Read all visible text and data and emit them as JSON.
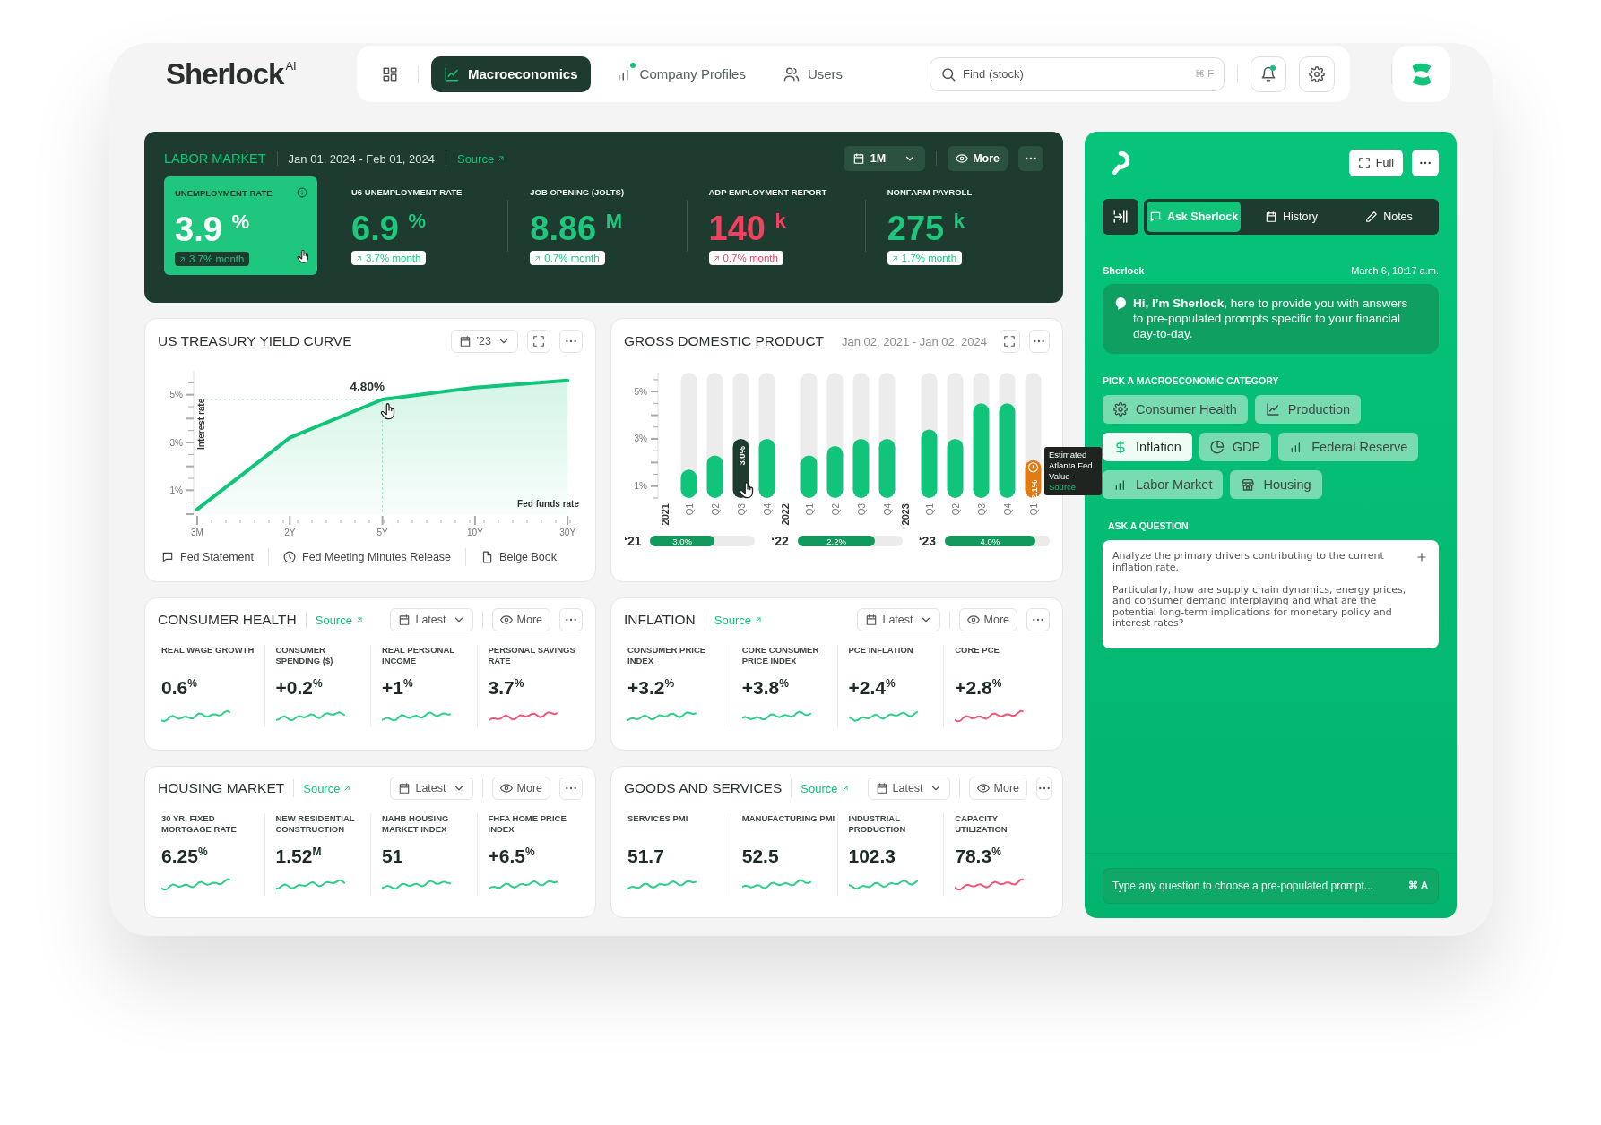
{
  "brand": {
    "name": "Sherlock",
    "suffix": "AI"
  },
  "nav": {
    "tabs": [
      {
        "label": "Macroeconomics",
        "selected": true,
        "dot": false
      },
      {
        "label": "Company Profiles",
        "selected": false,
        "dot": true
      },
      {
        "label": "Users",
        "selected": false,
        "dot": false
      }
    ],
    "search": {
      "placeholder": "Find (stock)",
      "shortcut": "⌘ F"
    },
    "notifications_unread": true
  },
  "labor_market": {
    "title": "LABOR MARKET",
    "date_range": "Jan 01, 2024 - Feb 01, 2024",
    "source": "Source",
    "period": "1M",
    "more": "More",
    "metrics": [
      {
        "label": "UNEMPLOYMENT RATE",
        "value": "3.9 $^{%}$",
        "change": "3.7% month",
        "color": "#1fc77e",
        "selected": true
      },
      {
        "label": "U6 UNEMPLOYMENT RATE",
        "value": "6.9 $^{%}$",
        "change": "3.7% month",
        "color": "#1fc77e",
        "selected": false
      },
      {
        "label": "JOB OPENING (JOLTS)",
        "value": "8.86 $^{M}$",
        "change": "0.7% month",
        "color": "#1fc77e",
        "selected": false
      },
      {
        "label": "ADP EMPLOYMENT REPORT",
        "value": "140 $^{k}$",
        "change": "0.7% month",
        "color": "#f0415f",
        "selected": false
      },
      {
        "label": "NONFARM PAYROLL",
        "value": "275 $^{k}$",
        "change": "1.7% month",
        "color": "#1fc77e",
        "selected": false
      }
    ]
  },
  "treasury": {
    "title": "US TREASURY YIELD CURVE",
    "period": "’23",
    "chart_data": {
      "type": "area",
      "ylabel": "Interest rate",
      "xlabel": "Fed funds rate",
      "categories": [
        "3M",
        "2Y",
        "5Y",
        "10Y",
        "30Y"
      ],
      "values": [
        0.2,
        3.2,
        4.8,
        5.3,
        5.6
      ],
      "ylim": [
        0,
        6
      ],
      "yticks": [
        {
          "value": 1,
          "label": "1%"
        },
        {
          "value": 3,
          "label": "3%"
        },
        {
          "value": 5,
          "label": "5%"
        }
      ],
      "annotations": [
        {
          "x": "5Y",
          "y": 4.8,
          "text": "4.80%"
        }
      ]
    },
    "links": [
      {
        "label": "Fed Statement"
      },
      {
        "label": "Fed Meeting Minutes Release"
      },
      {
        "label": "Beige Book"
      }
    ]
  },
  "gdp": {
    "title": "GROSS DOMESTIC PRODUCT",
    "date_range": "Jan 02, 2021 - Jan 02, 2024",
    "chart_data": {
      "type": "bar",
      "categories": [
        "Q1",
        "Q2",
        "Q3",
        "Q4",
        "Q1",
        "Q2",
        "Q3",
        "Q4",
        "Q1",
        "Q2",
        "Q3",
        "Q4",
        "Q1"
      ],
      "values": [
        1.7,
        2.3,
        3.0,
        3.0,
        2.3,
        2.7,
        3.0,
        3.0,
        3.4,
        3.0,
        4.5,
        4.5,
        2.1
      ],
      "ylim": [
        0.5,
        5.8
      ],
      "yticks": [
        {
          "value": 1,
          "label": "1%"
        },
        {
          "value": 3,
          "label": "3%"
        },
        {
          "value": 5,
          "label": "5%"
        }
      ],
      "value_labels": [
        null,
        null,
        "3.0%",
        null,
        null,
        null,
        null,
        null,
        null,
        null,
        null,
        null,
        "2.1%"
      ]
    },
    "year_labels": [
      "2021",
      "2022",
      "2023"
    ],
    "bars": [
      {
        "selected": false,
        "estimated": false
      },
      {
        "selected": false,
        "estimated": false
      },
      {
        "selected": true,
        "estimated": false
      },
      {
        "selected": false,
        "estimated": false
      },
      {
        "selected": false,
        "estimated": false
      },
      {
        "selected": false,
        "estimated": false
      },
      {
        "selected": false,
        "estimated": false
      },
      {
        "selected": false,
        "estimated": false
      },
      {
        "selected": false,
        "estimated": false
      },
      {
        "selected": false,
        "estimated": false
      },
      {
        "selected": false,
        "estimated": false
      },
      {
        "selected": false,
        "estimated": false
      },
      {
        "selected": false,
        "estimated": true
      }
    ],
    "tooltip": {
      "text": "Estimated Atlanta Fed Value -",
      "link": "Source"
    },
    "summary": [
      {
        "label": "‘21",
        "value": "3.0%",
        "level": 0.61
      },
      {
        "label": "‘22",
        "value": "2.2%",
        "level": 0.74
      },
      {
        "label": "‘23",
        "value": "4.0%",
        "level": 0.86
      }
    ]
  },
  "cards": [
    {
      "title": "CONSUMER HEALTH",
      "source": "Source",
      "period": "Latest",
      "more": "More",
      "metrics": [
        {
          "label": "REAL WAGE GROWTH",
          "value": "0.6$^{%}$",
          "color": "#2fcf8a"
        },
        {
          "label": "CONSUMER SPENDING ($)",
          "value": "+0.2$^{%}$",
          "color": "#2fcf8a"
        },
        {
          "label": "REAL PERSONAL INCOME",
          "value": "+1$^{%}$",
          "color": "#2fcf8a"
        },
        {
          "label": "PERSONAL SAVINGS RATE",
          "value": "3.7$^{%}$",
          "color": "#f0587a"
        }
      ]
    },
    {
      "title": "INFLATION",
      "source": "Source",
      "period": "Latest",
      "more": "More",
      "metrics": [
        {
          "label": "CONSUMER PRICE INDEX",
          "value": "+3.2$^{%}$",
          "color": "#2fcf8a"
        },
        {
          "label": "CORE CONSUMER PRICE INDEX",
          "value": "+3.8$^{%}$",
          "color": "#2fcf8a"
        },
        {
          "label": "PCE INFLATION",
          "value": "+2.4$^{%}$",
          "color": "#2fcf8a"
        },
        {
          "label": "CORE PCE",
          "value": "+2.8$^{%}$",
          "color": "#f0587a"
        }
      ]
    },
    {
      "title": "HOUSING MARKET",
      "source": "Source",
      "period": "Latest",
      "more": "More",
      "metrics": [
        {
          "label": "30 YR. FIXED MORTGAGE RATE",
          "value": "6.25$^{%}$",
          "color": "#2fcf8a"
        },
        {
          "label": "NEW RESIDENTIAL CONSTRUCTION",
          "value": "1.52$^{M}$",
          "color": "#2fcf8a"
        },
        {
          "label": "NAHB HOUSING MARKET INDEX",
          "value": "51",
          "color": "#2fcf8a"
        },
        {
          "label": "FHFA HOME PRICE INDEX",
          "value": "+6.5$^{%}$",
          "color": "#2fcf8a"
        }
      ]
    },
    {
      "title": "GOODS AND SERVICES",
      "source": "Source",
      "period": "Latest",
      "more": "More",
      "metrics": [
        {
          "label": "SERVICES PMI",
          "value": "51.7",
          "color": "#2fcf8a"
        },
        {
          "label": "MANUFACTURING PMI",
          "value": "52.5",
          "color": "#2fcf8a"
        },
        {
          "label": "INDUSTRIAL PRODUCTION",
          "value": "102.3",
          "color": "#2fcf8a"
        },
        {
          "label": "CAPACITY UTILIZATION",
          "value": "78.3$^{%}$",
          "color": "#f0587a"
        }
      ]
    }
  ],
  "assistant": {
    "full": "Full",
    "tabs": [
      {
        "label": "Ask Sherlock",
        "selected": true
      },
      {
        "label": "History",
        "selected": false
      },
      {
        "label": "Notes",
        "selected": false
      }
    ],
    "sender": "Sherlock",
    "time": "March 6, 10:17 a.m.",
    "message": "**Hi, I’m Sherlock**, here to provide you with answers to pre-populated prompts specific to your financial day-to-day.",
    "category_heading": "PICK A MACROECONOMIC CATEGORY",
    "categories": [
      {
        "label": "Consumer Health",
        "selected": false
      },
      {
        "label": "Production",
        "selected": false
      },
      {
        "label": "Inflation",
        "selected": true
      },
      {
        "label": "GDP",
        "selected": false
      },
      {
        "label": "Federal Reserve",
        "selected": false
      },
      {
        "label": "Labor Market",
        "selected": false
      },
      {
        "label": "Housing",
        "selected": false
      }
    ],
    "question_heading": "ASK A QUESTION",
    "question": "Analyze the primary drivers contributing to the current inflation rate.\n\nParticularly, how are supply chain dynamics, energy prices, and consumer demand interplaying and what are the potential long-term implications for monetary policy and interest rates?",
    "input_placeholder": "Type any question to choose a pre-populated prompt...",
    "input_shortcut": "⌘ A"
  }
}
